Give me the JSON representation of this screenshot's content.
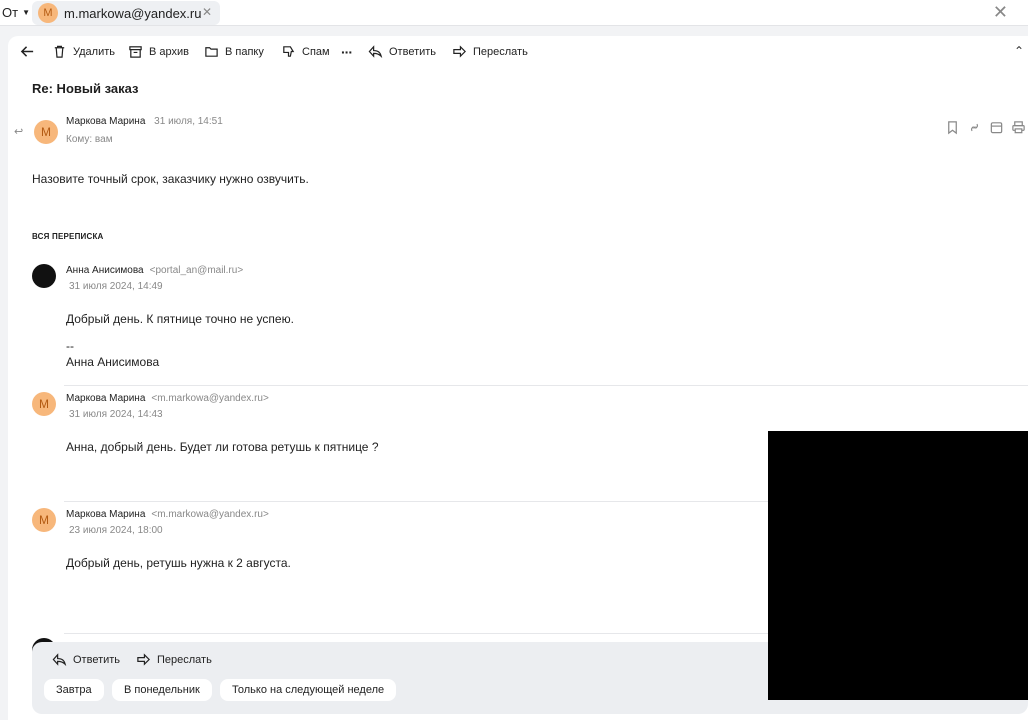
{
  "topbar": {
    "from_label": "От",
    "chip_avatar": "М",
    "chip_email": "m.markowa@yandex.ru"
  },
  "toolbar": {
    "delete": "Удалить",
    "archive": "В архив",
    "to_folder": "В папку",
    "spam": "Спам",
    "reply": "Ответить",
    "forward": "Переслать"
  },
  "subject": "Re: Новый заказ",
  "current_message": {
    "avatar": "М",
    "sender": "Маркова Марина",
    "date": "31 июля, 14:51",
    "to": "Кому: вам",
    "body": "Назовите точный срок, заказчику нужно озвучить."
  },
  "thread_title": "ВСЯ ПЕРЕПИСКА",
  "thread": [
    {
      "sender": "Анна Анисимова",
      "email": "<portal_an@mail.ru>",
      "date": "31 июля 2024, 14:49",
      "body": "Добрый день. К пятнице точно не успею.",
      "sig_sep": "--",
      "signature": "Анна Анисимова"
    },
    {
      "avatar": "М",
      "sender": "Маркова Марина",
      "email": "<m.markowa@yandex.ru>",
      "date": "31 июля 2024, 14:43",
      "body": "Анна, добрый день. Будет ли готова ретушь к пятнице ?"
    },
    {
      "avatar": "М",
      "sender": "Маркова Марина",
      "email": "<m.markowa@yandex.ru>",
      "date": "23 июля 2024, 18:00",
      "body": "Добрый день, ретушь нужна к 2 августа."
    }
  ],
  "bottom": {
    "reply": "Ответить",
    "forward": "Переслать",
    "quick": [
      "Завтра",
      "В понедельник",
      "Только на следующей неделе"
    ]
  },
  "colors": {
    "avatar_bg": "#f7b77b",
    "panel_bg": "#ffffff",
    "page_bg": "#f2f3f5"
  }
}
